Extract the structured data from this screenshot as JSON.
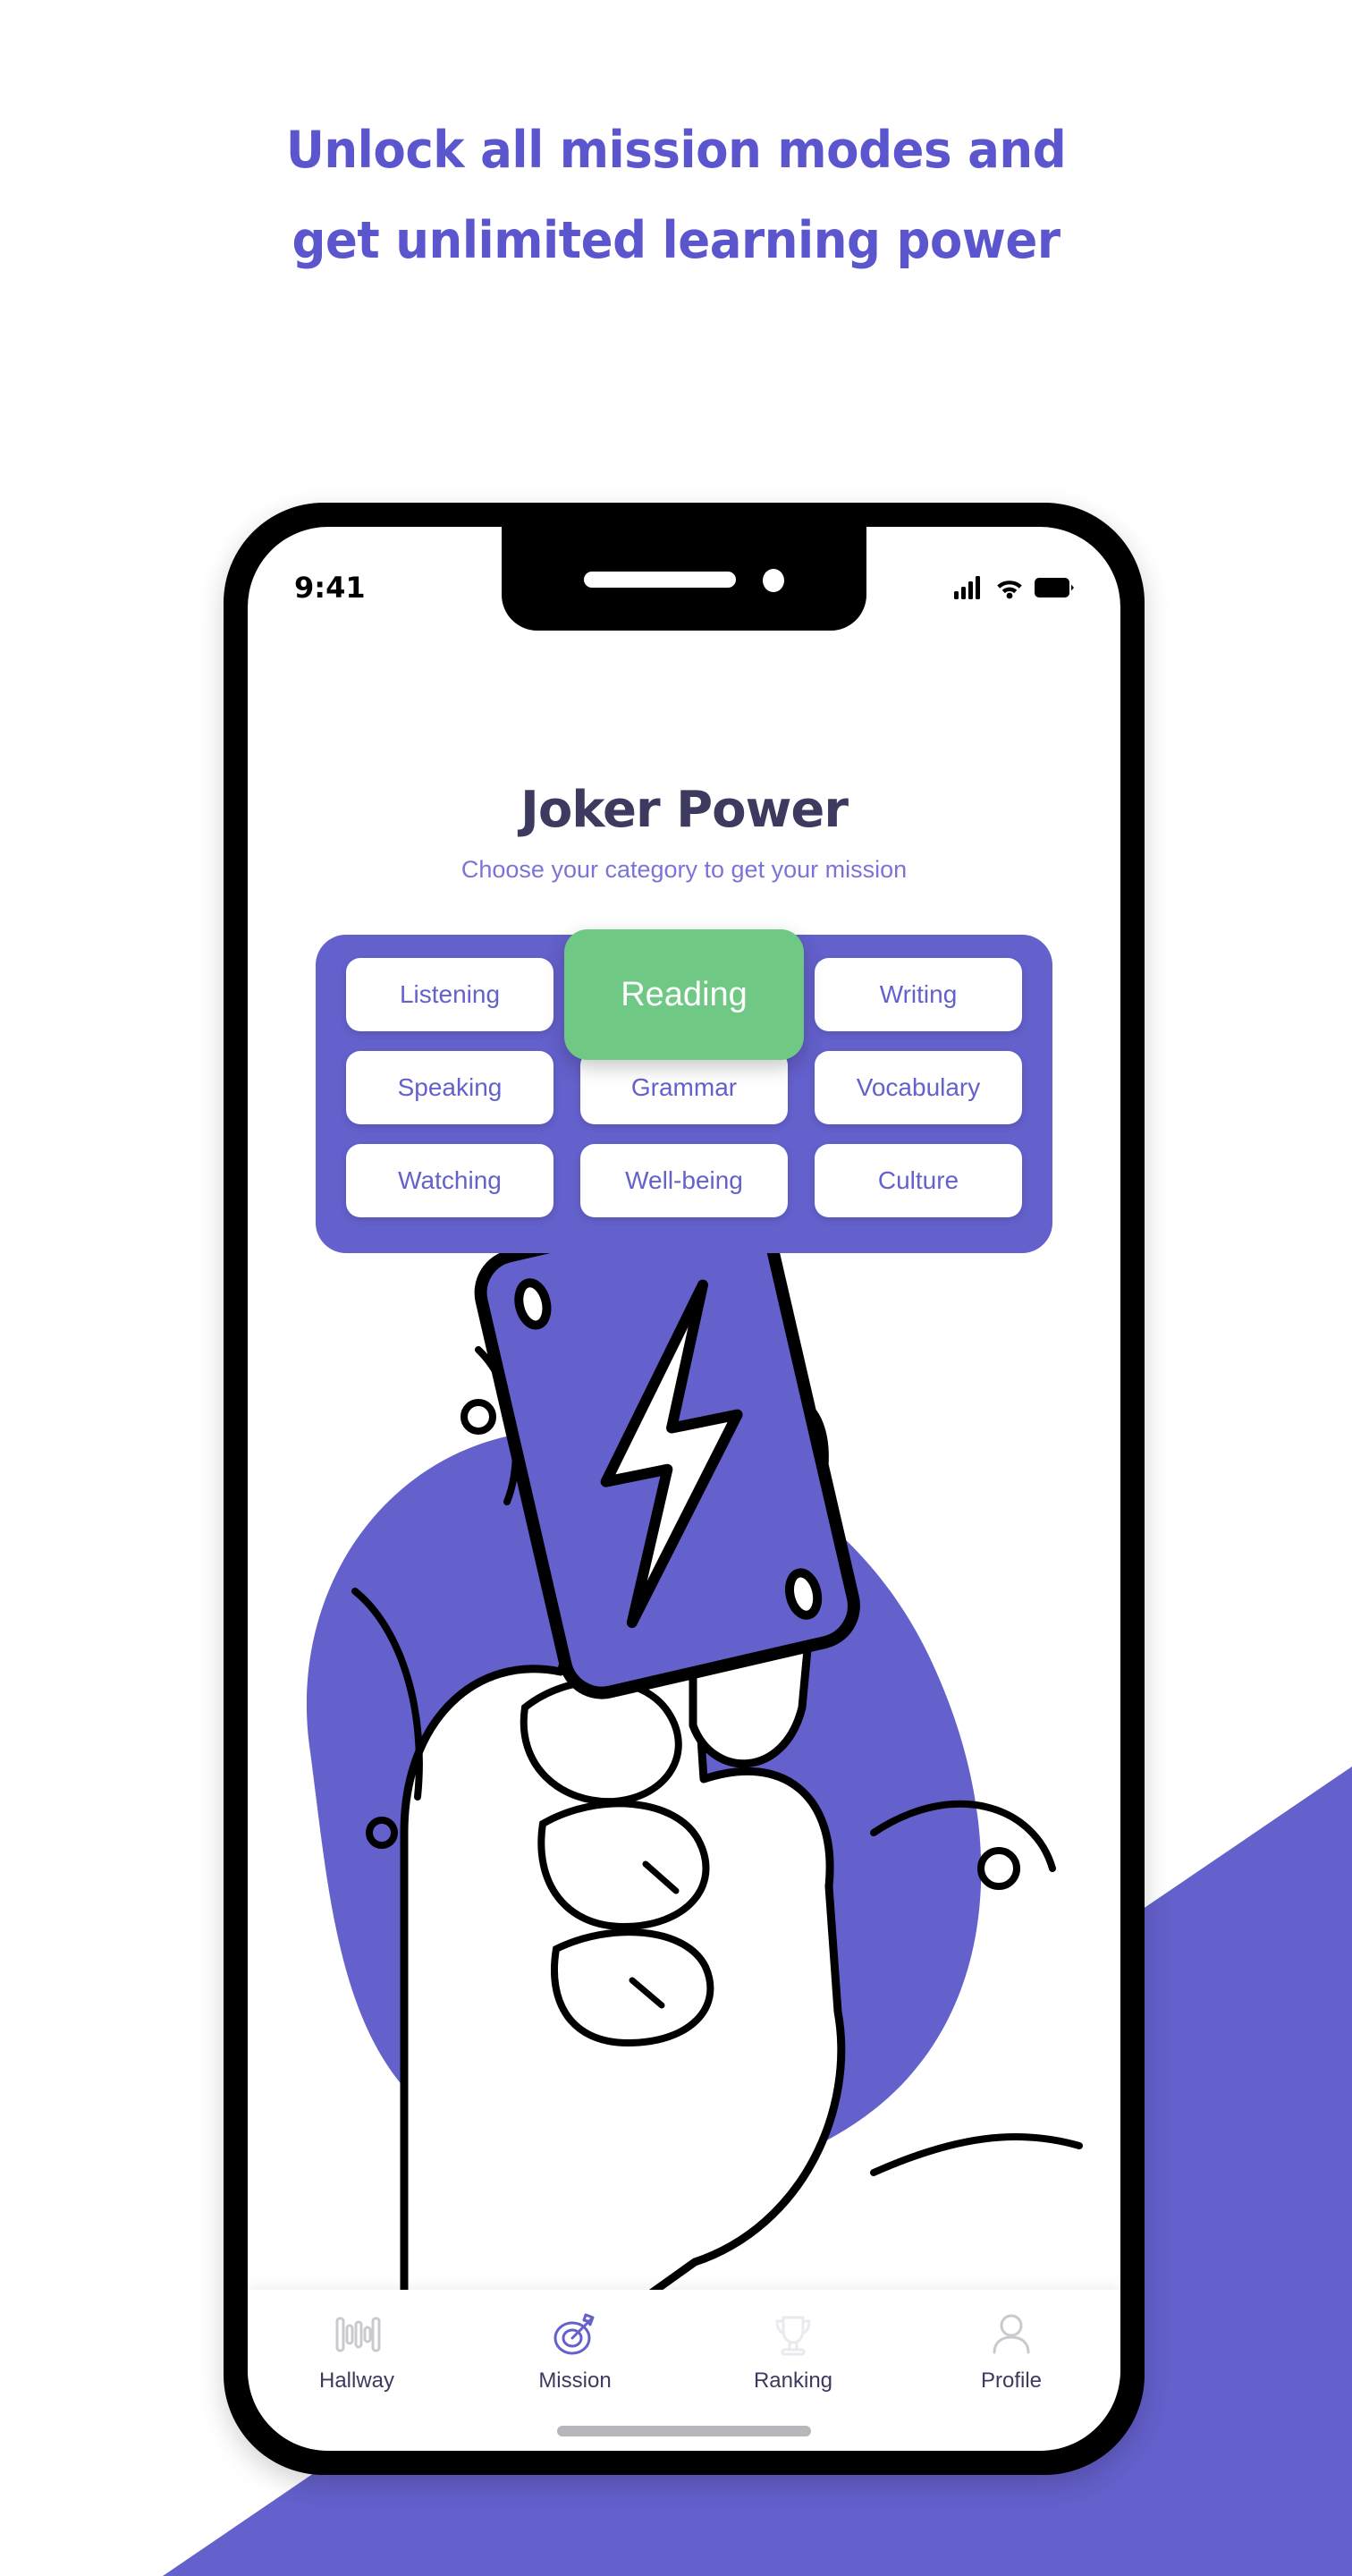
{
  "colors": {
    "brand_purple": "#6460CC",
    "headline_purple": "#5B55CE",
    "title_navy": "#3C3A5E",
    "selected_green": "#6FC985",
    "subtitle_purple": "#7B74D8",
    "background_white": "#FFFFFF",
    "frame_black": "#000000",
    "inactive_gray": "#C9C9CE"
  },
  "headline": {
    "line1": "Unlock all mission modes and",
    "line2": "get unlimited learning power"
  },
  "phone": {
    "status_bar": {
      "time": "9:41",
      "icons": [
        "cellular-signal-icon",
        "wifi-icon",
        "battery-icon"
      ]
    },
    "home_indicator": "home-indicator"
  },
  "app": {
    "title": "Joker Power",
    "subtitle": "Choose your category to get your mission",
    "categories": {
      "selected": "Reading",
      "rows": [
        [
          {
            "label": "Listening",
            "selected": false
          },
          {
            "label": "Reading",
            "selected": true
          },
          {
            "label": "Writing",
            "selected": false
          }
        ],
        [
          {
            "label": "Speaking",
            "selected": false
          },
          {
            "label": "Grammar",
            "selected": false
          },
          {
            "label": "Vocabulary",
            "selected": false
          }
        ],
        [
          {
            "label": "Watching",
            "selected": false
          },
          {
            "label": "Well-being",
            "selected": false
          },
          {
            "label": "Culture",
            "selected": false
          }
        ]
      ]
    },
    "illustration": {
      "description": "hand pointing up at a tilted purple card with a white lightning bolt",
      "card_icon": "lightning-bolt-icon"
    },
    "tabs": [
      {
        "label": "Hallway",
        "icon": "waveform-icon",
        "active": false
      },
      {
        "label": "Mission",
        "icon": "target-arrow-icon",
        "active": true
      },
      {
        "label": "Ranking",
        "icon": "trophy-icon",
        "active": false
      },
      {
        "label": "Profile",
        "icon": "person-icon",
        "active": false
      }
    ]
  }
}
